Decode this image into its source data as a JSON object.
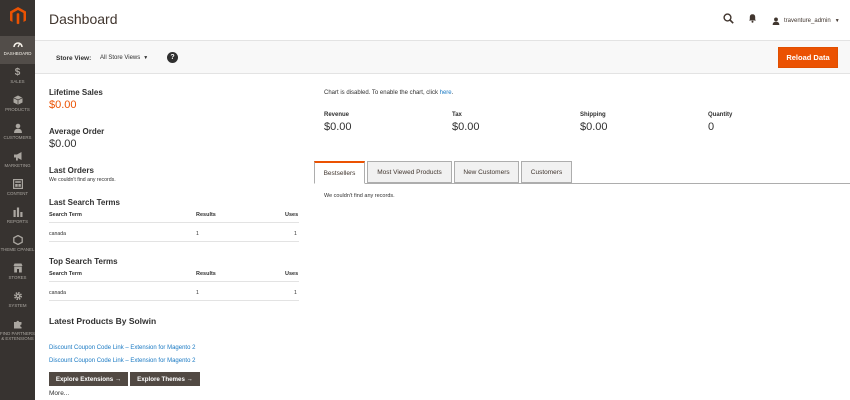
{
  "sidebar": {
    "items": [
      {
        "label": "DASHBOARD",
        "icon": "dashboard-icon"
      },
      {
        "label": "SALES",
        "icon": "dollar-icon"
      },
      {
        "label": "PRODUCTS",
        "icon": "cube-icon"
      },
      {
        "label": "CUSTOMERS",
        "icon": "person-icon"
      },
      {
        "label": "MARKETING",
        "icon": "megaphone-icon"
      },
      {
        "label": "CONTENT",
        "icon": "layout-icon"
      },
      {
        "label": "REPORTS",
        "icon": "bar-chart-icon"
      },
      {
        "label": "THEME CPANEL",
        "icon": "hexagon-icon"
      },
      {
        "label": "STORES",
        "icon": "store-icon"
      },
      {
        "label": "SYSTEM",
        "icon": "gear-icon"
      },
      {
        "label": "FIND PARTNERS & EXTENSIONS",
        "label_lines": [
          "FIND PARTNERS",
          "& EXTENSIONS"
        ],
        "icon": "puzzle-icon"
      }
    ]
  },
  "header": {
    "title": "Dashboard",
    "user": "traventure_admin"
  },
  "toolbar": {
    "store_view_label": "Store View:",
    "store_view_value": "All Store Views",
    "help": "?",
    "reload_label": "Reload Data"
  },
  "left": {
    "lifetime_sales_label": "Lifetime Sales",
    "lifetime_sales_value": "$0.00",
    "average_order_label": "Average Order",
    "average_order_value": "$0.00",
    "last_orders_label": "Last Orders",
    "last_orders_empty": "We couldn't find any records.",
    "last_search": {
      "title": "Last Search Terms",
      "columns": [
        "Search Term",
        "Results",
        "Uses"
      ],
      "rows": [
        [
          "canada",
          "1",
          "1"
        ]
      ]
    },
    "top_search": {
      "title": "Top Search Terms",
      "columns": [
        "Search Term",
        "Results",
        "Uses"
      ],
      "rows": [
        [
          "canada",
          "1",
          "1"
        ]
      ]
    },
    "latest_products": {
      "title": "Latest Products By Solwin",
      "links": [
        "Discount Coupon Code Link – Extension for Magento 2",
        "Discount Coupon Code Link – Extension for Magento 2"
      ],
      "explore_extensions": "Explore Extensions →",
      "explore_themes": "Explore Themes →",
      "more": "More..."
    }
  },
  "chart": {
    "message": "Chart is disabled. To enable the chart, click ",
    "link": "here",
    "suffix": "."
  },
  "totals": [
    {
      "label": "Revenue",
      "value": "$0.00",
      "accent": true
    },
    {
      "label": "Tax",
      "value": "$0.00",
      "accent": false
    },
    {
      "label": "Shipping",
      "value": "$0.00",
      "accent": false
    },
    {
      "label": "Quantity",
      "value": "0",
      "accent": false
    }
  ],
  "tabs": {
    "items": [
      "Bestsellers",
      "Most Viewed Products",
      "New Customers",
      "Customers"
    ],
    "active": "Bestsellers",
    "empty": "We couldn't find any records."
  },
  "colors": {
    "accent": "#eb5202",
    "sidebar": "#373330",
    "link": "#1979c3"
  }
}
